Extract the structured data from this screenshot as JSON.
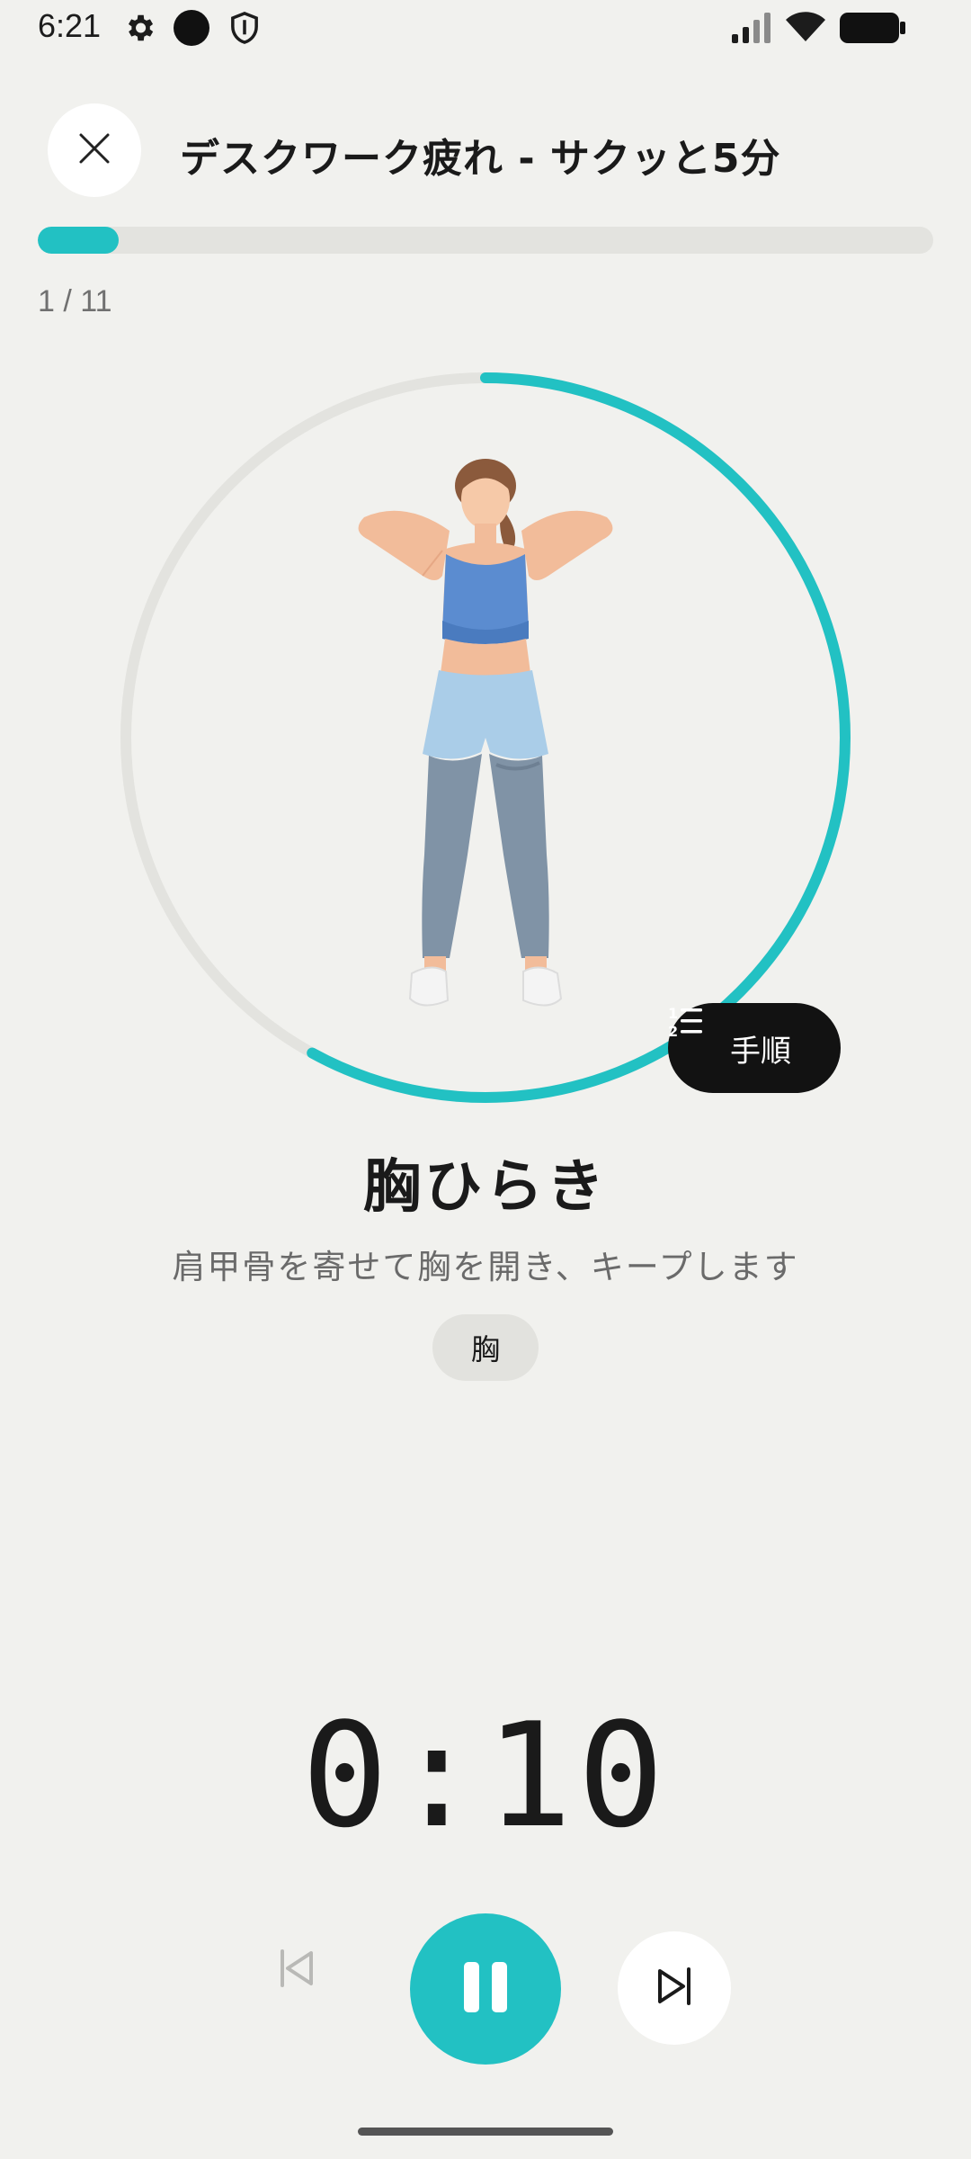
{
  "status_bar": {
    "time": "6:21",
    "icons": [
      "settings-icon",
      "record-dot-icon",
      "shield-icon",
      "signal-icon",
      "wifi-icon",
      "battery-icon"
    ]
  },
  "header": {
    "title": "デスクワーク疲れ - サクッと5分",
    "close_icon": "close-icon"
  },
  "progress": {
    "fraction": 0.09,
    "counter": "1 / 11"
  },
  "timer_ring": {
    "fraction": 0.58,
    "color": "#22c1c3"
  },
  "steps_button": {
    "label": "手順",
    "icon": "numbered-list-icon"
  },
  "exercise": {
    "name": "胸ひらき",
    "description": "肩甲骨を寄せて胸を開き、キープします",
    "tag": "胸"
  },
  "timer": {
    "value": "0:10"
  },
  "controls": {
    "previous_icon": "skip-previous-icon",
    "pause_icon": "pause-icon",
    "next_icon": "skip-next-icon"
  },
  "colors": {
    "accent": "#22c1c3",
    "background": "#f1f1ee",
    "dark": "#121212"
  }
}
